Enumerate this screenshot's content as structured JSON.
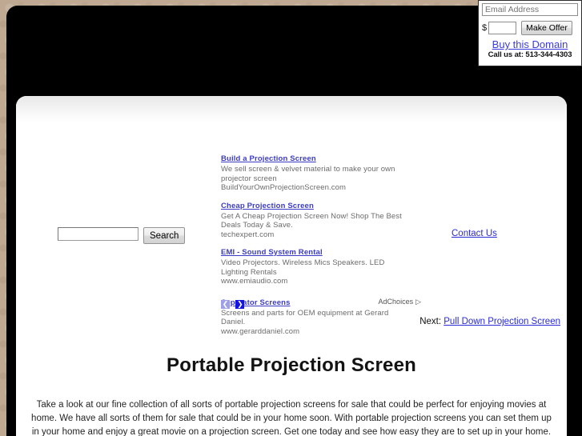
{
  "domain_widget": {
    "email_placeholder": "Email Address",
    "email_value": "",
    "currency_symbol": "$",
    "price_value": "",
    "make_offer_label": "Make Offer",
    "buy_domain_label": "Buy this Domain",
    "call_us_label": "Call us at: 513-344-4303"
  },
  "search": {
    "value": "",
    "button_label": "Search"
  },
  "ads": {
    "items": [
      {
        "title": "Build a Projection Screen",
        "description": "We sell screen & velvet material to make your own projector screen",
        "url": "BuildYourOwnProjectionScreen.com"
      },
      {
        "title": "Cheap Projection Screen",
        "description": "Get A Cheap Projection Screen Now! Shop The Best Deals Today & Save.",
        "url": "techexpert.com"
      },
      {
        "title": "EMI - Sound System Rental",
        "description": "Video Projectors. Wireless Mics Speakers. LED Lighting Rentals",
        "url": "www.emiaudio.com"
      },
      {
        "title": "Separator Screens",
        "description": "Screens and parts for OEM equipment at Gerard Daniel.",
        "url": "www.gerarddaniel.com"
      }
    ],
    "prev_arrow": "❮",
    "next_arrow": "❯",
    "adchoices_label": "AdChoices",
    "adchoices_icon": "▷"
  },
  "contact": {
    "label": "Contact Us"
  },
  "next": {
    "prefix": "Next:",
    "link_label": "Pull Down Projection Screen"
  },
  "page": {
    "title": "Portable Projection Screen",
    "body": "Take a look at our fine collection of all sorts of portable projection screens for sale that could be perfect for enjoying movies at home. We have all sorts of them for sale that could be in your home soon. With portable projection screens you can set them up in your home and enjoy a great movie on a projection screen. Get one today and see how easy they are to set up in your home."
  },
  "colors": {
    "background_tan": "#bfa992",
    "frame_black": "#000000",
    "panel_white": "#ffffff",
    "link_blue": "#2b2bd4",
    "ad_title_blue": "#3b3bc4",
    "ad_text_gray": "#6b6b6b",
    "next_arrow_blue": "#1414e0",
    "prev_arrow_blue": "#a0a0e8"
  }
}
